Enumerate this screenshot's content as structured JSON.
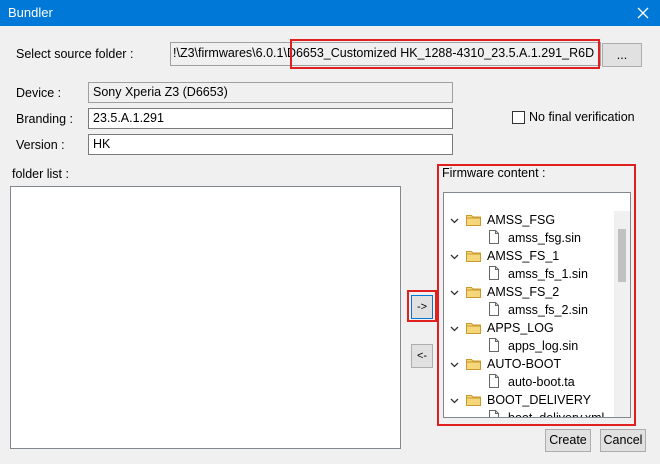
{
  "window": {
    "title": "Bundler"
  },
  "source": {
    "label": "Select source folder :",
    "path_prefix": "!\\Z3\\firmwares\\6.0.1\\",
    "path_highlight": "D6653_Customized HK_1288-4310_23.5.A.1.291_R6D",
    "browse_label": "..."
  },
  "device": {
    "label": "Device :",
    "value": "Sony Xperia Z3 (D6653)"
  },
  "branding": {
    "label": "Branding :",
    "value": "23.5.A.1.291"
  },
  "version": {
    "label": "Version :",
    "value": "HK"
  },
  "no_final_verification": {
    "label": "No final verification",
    "checked": false
  },
  "folder_list": {
    "label": "folder list :"
  },
  "firmware_content": {
    "label": "Firmware content :",
    "items": [
      {
        "name": "AMSS_FSG",
        "file": "amss_fsg.sin"
      },
      {
        "name": "AMSS_FS_1",
        "file": "amss_fs_1.sin"
      },
      {
        "name": "AMSS_FS_2",
        "file": "amss_fs_2.sin"
      },
      {
        "name": "APPS_LOG",
        "file": "apps_log.sin"
      },
      {
        "name": "AUTO-BOOT",
        "file": "auto-boot.ta"
      },
      {
        "name": "BOOT_DELIVERY",
        "file": "boot_delivery.xml"
      }
    ]
  },
  "move_right_label": "->",
  "move_left_label": "<-",
  "create_label": "Create",
  "cancel_label": "Cancel",
  "colors": {
    "title_bar": "#0078d7",
    "highlight": "#e02020",
    "folder": "#dcb35c"
  },
  "icons": [
    "close-icon",
    "folder-icon",
    "file-icon",
    "chevron-down-icon"
  ]
}
